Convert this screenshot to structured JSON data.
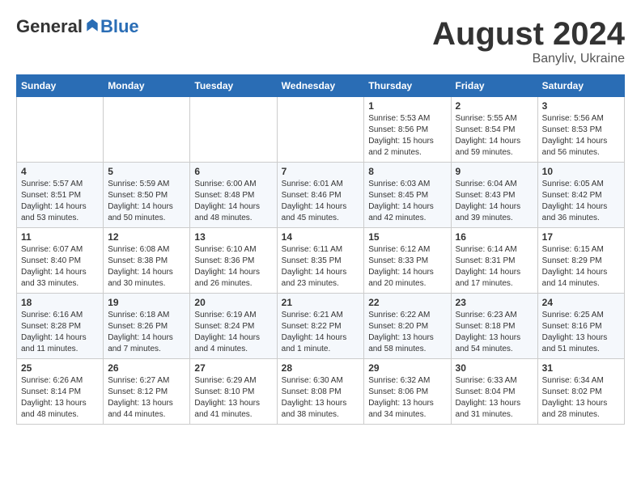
{
  "header": {
    "logo_general": "General",
    "logo_blue": "Blue",
    "month_year": "August 2024",
    "location": "Banyliv, Ukraine"
  },
  "days_of_week": [
    "Sunday",
    "Monday",
    "Tuesday",
    "Wednesday",
    "Thursday",
    "Friday",
    "Saturday"
  ],
  "weeks": [
    [
      {
        "num": "",
        "info": ""
      },
      {
        "num": "",
        "info": ""
      },
      {
        "num": "",
        "info": ""
      },
      {
        "num": "",
        "info": ""
      },
      {
        "num": "1",
        "info": "Sunrise: 5:53 AM\nSunset: 8:56 PM\nDaylight: 15 hours and 2 minutes."
      },
      {
        "num": "2",
        "info": "Sunrise: 5:55 AM\nSunset: 8:54 PM\nDaylight: 14 hours and 59 minutes."
      },
      {
        "num": "3",
        "info": "Sunrise: 5:56 AM\nSunset: 8:53 PM\nDaylight: 14 hours and 56 minutes."
      }
    ],
    [
      {
        "num": "4",
        "info": "Sunrise: 5:57 AM\nSunset: 8:51 PM\nDaylight: 14 hours and 53 minutes."
      },
      {
        "num": "5",
        "info": "Sunrise: 5:59 AM\nSunset: 8:50 PM\nDaylight: 14 hours and 50 minutes."
      },
      {
        "num": "6",
        "info": "Sunrise: 6:00 AM\nSunset: 8:48 PM\nDaylight: 14 hours and 48 minutes."
      },
      {
        "num": "7",
        "info": "Sunrise: 6:01 AM\nSunset: 8:46 PM\nDaylight: 14 hours and 45 minutes."
      },
      {
        "num": "8",
        "info": "Sunrise: 6:03 AM\nSunset: 8:45 PM\nDaylight: 14 hours and 42 minutes."
      },
      {
        "num": "9",
        "info": "Sunrise: 6:04 AM\nSunset: 8:43 PM\nDaylight: 14 hours and 39 minutes."
      },
      {
        "num": "10",
        "info": "Sunrise: 6:05 AM\nSunset: 8:42 PM\nDaylight: 14 hours and 36 minutes."
      }
    ],
    [
      {
        "num": "11",
        "info": "Sunrise: 6:07 AM\nSunset: 8:40 PM\nDaylight: 14 hours and 33 minutes."
      },
      {
        "num": "12",
        "info": "Sunrise: 6:08 AM\nSunset: 8:38 PM\nDaylight: 14 hours and 30 minutes."
      },
      {
        "num": "13",
        "info": "Sunrise: 6:10 AM\nSunset: 8:36 PM\nDaylight: 14 hours and 26 minutes."
      },
      {
        "num": "14",
        "info": "Sunrise: 6:11 AM\nSunset: 8:35 PM\nDaylight: 14 hours and 23 minutes."
      },
      {
        "num": "15",
        "info": "Sunrise: 6:12 AM\nSunset: 8:33 PM\nDaylight: 14 hours and 20 minutes."
      },
      {
        "num": "16",
        "info": "Sunrise: 6:14 AM\nSunset: 8:31 PM\nDaylight: 14 hours and 17 minutes."
      },
      {
        "num": "17",
        "info": "Sunrise: 6:15 AM\nSunset: 8:29 PM\nDaylight: 14 hours and 14 minutes."
      }
    ],
    [
      {
        "num": "18",
        "info": "Sunrise: 6:16 AM\nSunset: 8:28 PM\nDaylight: 14 hours and 11 minutes."
      },
      {
        "num": "19",
        "info": "Sunrise: 6:18 AM\nSunset: 8:26 PM\nDaylight: 14 hours and 7 minutes."
      },
      {
        "num": "20",
        "info": "Sunrise: 6:19 AM\nSunset: 8:24 PM\nDaylight: 14 hours and 4 minutes."
      },
      {
        "num": "21",
        "info": "Sunrise: 6:21 AM\nSunset: 8:22 PM\nDaylight: 14 hours and 1 minute."
      },
      {
        "num": "22",
        "info": "Sunrise: 6:22 AM\nSunset: 8:20 PM\nDaylight: 13 hours and 58 minutes."
      },
      {
        "num": "23",
        "info": "Sunrise: 6:23 AM\nSunset: 8:18 PM\nDaylight: 13 hours and 54 minutes."
      },
      {
        "num": "24",
        "info": "Sunrise: 6:25 AM\nSunset: 8:16 PM\nDaylight: 13 hours and 51 minutes."
      }
    ],
    [
      {
        "num": "25",
        "info": "Sunrise: 6:26 AM\nSunset: 8:14 PM\nDaylight: 13 hours and 48 minutes."
      },
      {
        "num": "26",
        "info": "Sunrise: 6:27 AM\nSunset: 8:12 PM\nDaylight: 13 hours and 44 minutes."
      },
      {
        "num": "27",
        "info": "Sunrise: 6:29 AM\nSunset: 8:10 PM\nDaylight: 13 hours and 41 minutes."
      },
      {
        "num": "28",
        "info": "Sunrise: 6:30 AM\nSunset: 8:08 PM\nDaylight: 13 hours and 38 minutes."
      },
      {
        "num": "29",
        "info": "Sunrise: 6:32 AM\nSunset: 8:06 PM\nDaylight: 13 hours and 34 minutes."
      },
      {
        "num": "30",
        "info": "Sunrise: 6:33 AM\nSunset: 8:04 PM\nDaylight: 13 hours and 31 minutes."
      },
      {
        "num": "31",
        "info": "Sunrise: 6:34 AM\nSunset: 8:02 PM\nDaylight: 13 hours and 28 minutes."
      }
    ]
  ]
}
